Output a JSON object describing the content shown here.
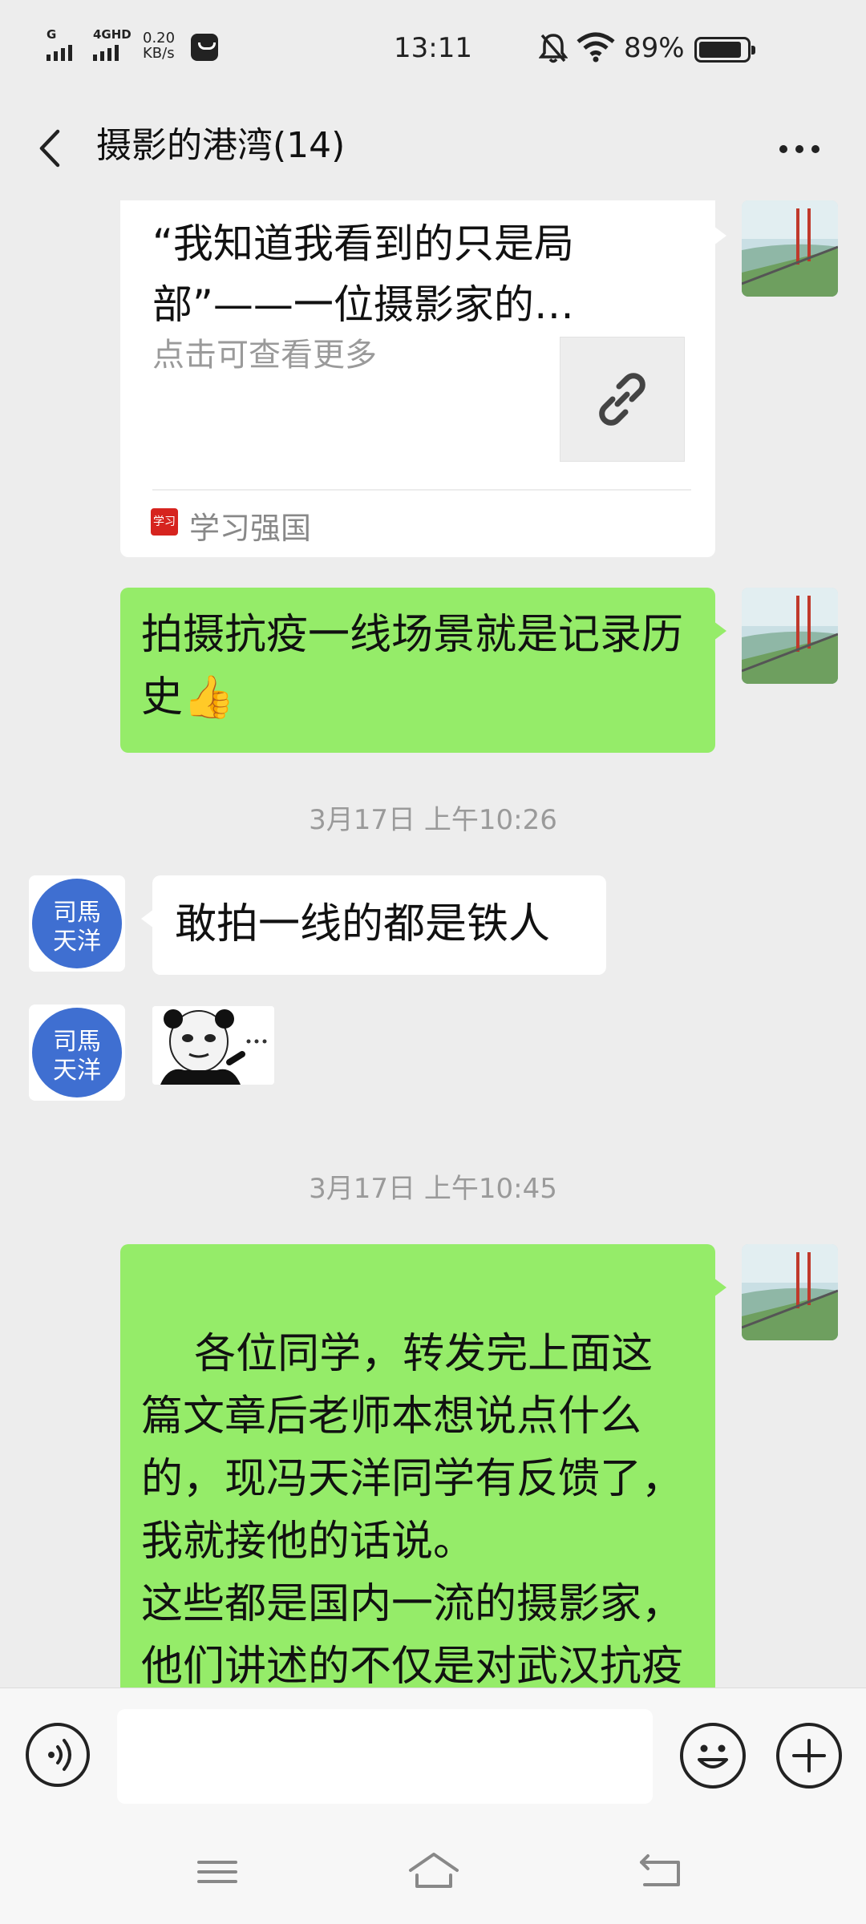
{
  "status_bar": {
    "signal_1_label": "G",
    "signal_2_label": "4GHD",
    "net_speed_value": "0.20",
    "net_speed_unit": "KB/s",
    "time": "13:11",
    "battery_percent": "89%",
    "battery_level": 0.89,
    "icons": [
      "message-icon",
      "mute-bell-icon",
      "wifi-icon",
      "battery-icon"
    ]
  },
  "header": {
    "title": "摄影的港湾(14)",
    "back_icon": "chevron-left-icon",
    "more_icon": "more-dots-icon"
  },
  "chat": {
    "link_card": {
      "title": "“我知道我看到的只是局部”——一位摄影家的…",
      "description": "点击可查看更多",
      "source": "学习强国",
      "source_icon_text": "学习",
      "thumb_icon": "link-icon"
    },
    "messages": [
      {
        "sender": "self",
        "text": "拍摄抗疫一线场景就是记录历史👍"
      },
      {
        "timestamp": "3月17日 上午10:26"
      },
      {
        "sender": "other",
        "text": "敢拍一线的都是铁人"
      },
      {
        "sender": "other",
        "type": "sticker",
        "sticker": "panda-meme"
      },
      {
        "timestamp": "3月17日 上午10:45"
      },
      {
        "sender": "self",
        "text": "各位同学，转发完上面这篇文章后老师本想说点什么的，现冯天洋同学有反馈了，我就接他的话说。\n这些都是国内一流的摄影家，他们讲述的不仅是对武汉抗疫一线现场的真情实感，而"
      }
    ],
    "other_avatar_text": "司馬天洋",
    "accent_green": "#95ec69"
  },
  "input_bar": {
    "value": "",
    "voice_icon": "voice-icon",
    "emoji_icon": "emoji-icon",
    "plus_icon": "plus-icon"
  },
  "nav_bar": {
    "icons": [
      "menu-icon",
      "home-icon",
      "back-icon"
    ]
  }
}
